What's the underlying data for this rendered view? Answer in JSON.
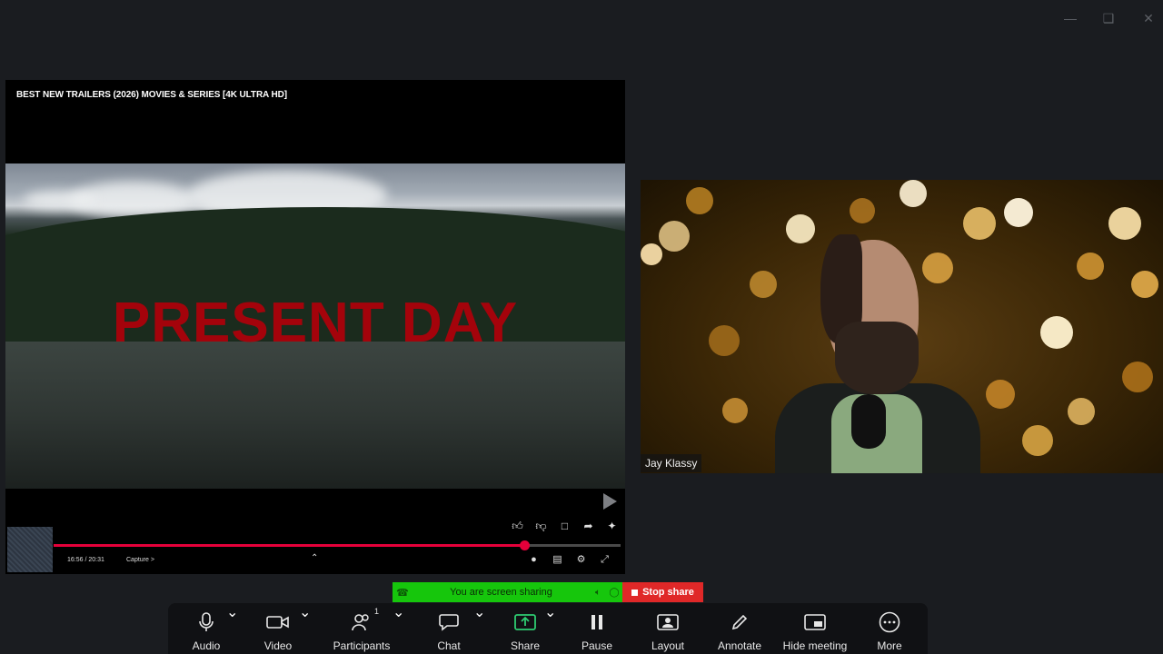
{
  "window": {
    "minimize_icon": "minimize-icon",
    "maximize_icon": "restore-icon",
    "close_icon": "close-icon"
  },
  "shared_screen": {
    "video_title": "BEST NEW TRAILERS (2026) MOVIES & SERIES [4K ULTRA HD]",
    "overlay_text": "PRESENT DAY",
    "time": "16:56 / 20:31",
    "chapter": "Capture",
    "chapter_arrow": ">",
    "progress": 0.83,
    "actions": [
      "like-icon",
      "dislike-icon",
      "comment-icon",
      "share-icon",
      "sparkle-icon"
    ],
    "controls": [
      "autoplay-icon",
      "captions-icon",
      "settings-icon",
      "exit-fullscreen-icon"
    ]
  },
  "participant": {
    "name": "Jay Klassy"
  },
  "share_banner": {
    "status_text": "You are screen sharing",
    "stop_label": "Stop share",
    "colors": {
      "banner": "#16c60c",
      "stop": "#e02828"
    }
  },
  "toolbar": {
    "audio": "Audio",
    "video": "Video",
    "participants": "Participants",
    "participants_count": "1",
    "chat": "Chat",
    "share": "Share",
    "pause": "Pause",
    "layout": "Layout",
    "annotate": "Annotate",
    "hide_meeting": "Hide meeting",
    "more": "More",
    "share_accent": "#2ecc71"
  }
}
